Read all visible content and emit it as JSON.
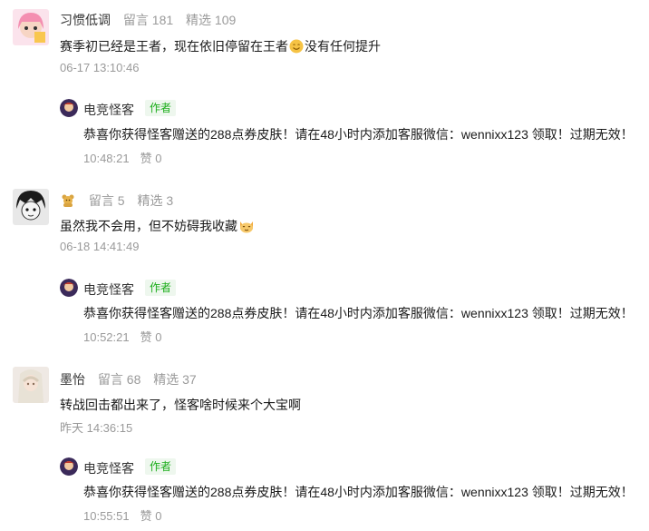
{
  "comments": [
    {
      "nickname": "习惯低调",
      "comments_count": "留言 181",
      "featured_count": "精选 109",
      "text_before": "赛季初已经是王者，现在依旧停留在王者",
      "emoji": "smile-emoji",
      "text_after": "没有任何提升",
      "time": "06-17 13:10:46",
      "reply": {
        "name": "电竞怪客",
        "badge": "作者",
        "text": "恭喜你获得怪客赠送的288点券皮肤！请在48小时内添加客服微信：wennixx123 领取！过期无效！",
        "time": "10:48:21",
        "like": "赞 0"
      }
    },
    {
      "nickname": "",
      "nickname_icon": "teddy-bear-icon",
      "comments_count": "留言 5",
      "featured_count": "精选 3",
      "text_before": "虽然我不会用，但不妨碍我收藏",
      "emoji": "cat-emoji",
      "text_after": "",
      "time": "06-18 14:41:49",
      "reply": {
        "name": "电竞怪客",
        "badge": "作者",
        "text": "恭喜你获得怪客赠送的288点券皮肤！请在48小时内添加客服微信：wennixx123 领取！过期无效！",
        "time": "10:52:21",
        "like": "赞 0"
      }
    },
    {
      "nickname": "墨怡",
      "comments_count": "留言 68",
      "featured_count": "精选 37",
      "text_before": "转战回击都出来了，怪客啥时候来个大宝啊",
      "emoji": "",
      "text_after": "",
      "time": "昨天 14:36:15",
      "reply": {
        "name": "电竞怪客",
        "badge": "作者",
        "text": "恭喜你获得怪客赠送的288点券皮肤！请在48小时内添加客服微信：wennixx123 领取！过期无效！",
        "time": "10:55:51",
        "like": "赞 0"
      }
    }
  ]
}
